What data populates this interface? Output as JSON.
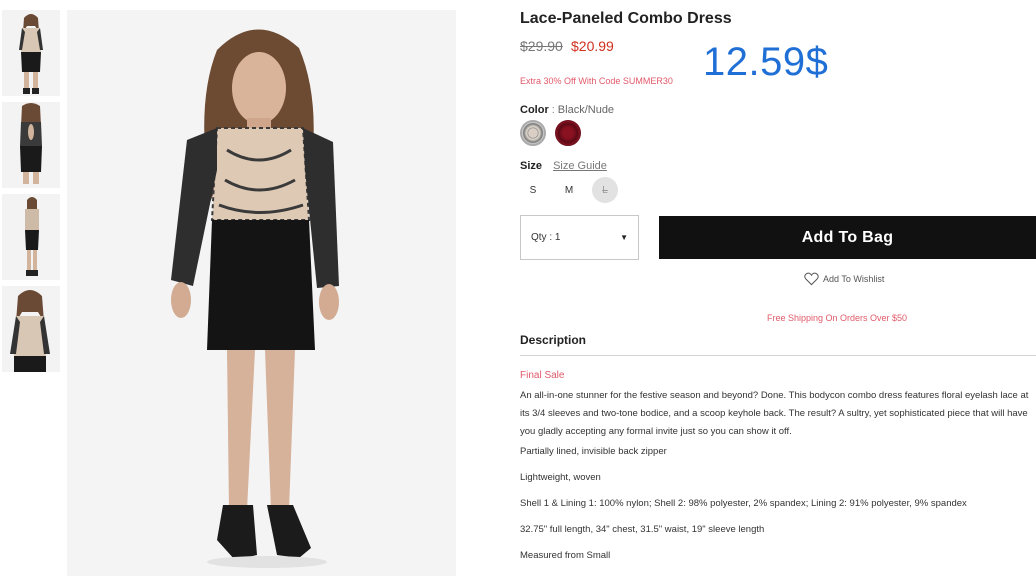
{
  "product": {
    "title": "Lace-Paneled Combo Dress",
    "price_original": "$29.90",
    "price_sale": "$20.99",
    "overlay_price": "12.59$",
    "promo": "Extra 30% Off With Code SUMMER30",
    "color_label": "Color",
    "color_separator": ":",
    "color_value": "Black/Nude",
    "swatches": [
      "black-nude-swatch",
      "red-swatch"
    ],
    "size_label": "Size",
    "size_guide": "Size Guide",
    "sizes": [
      "S",
      "M",
      "L"
    ],
    "qty_label": "Qty : 1",
    "add_to_bag": "Add To Bag",
    "wishlist": "Add To Wishlist",
    "free_shipping": "Free Shipping On Orders Over $50"
  },
  "description": {
    "heading": "Description",
    "final_sale": "Final Sale",
    "body": "An all-in-one stunner for the festive season and beyond? Done. This bodycon combo dress features floral eyelash lace at its 3/4 sleeves and two-tone bodice, and a scoop keyhole back. The result? A sultry, yet sophisticated piece that will have you gladly accepting any formal invite just so you can show it off.",
    "details": [
      "Partially lined, invisible back zipper",
      "Lightweight, woven",
      "Shell 1 & Lining 1: 100% nylon; Shell 2: 98% polyester, 2% spandex; Lining 2: 91% polyester, 9% spandex",
      "32.75\" full length, 34\" chest, 31.5\" waist, 19\" sleeve length",
      "Measured from Small"
    ]
  },
  "colors": {
    "accent_red": "#d0311e",
    "promo_pink": "#e05a6a",
    "overlay_blue": "#1f6fd6",
    "button_black": "#111111"
  }
}
